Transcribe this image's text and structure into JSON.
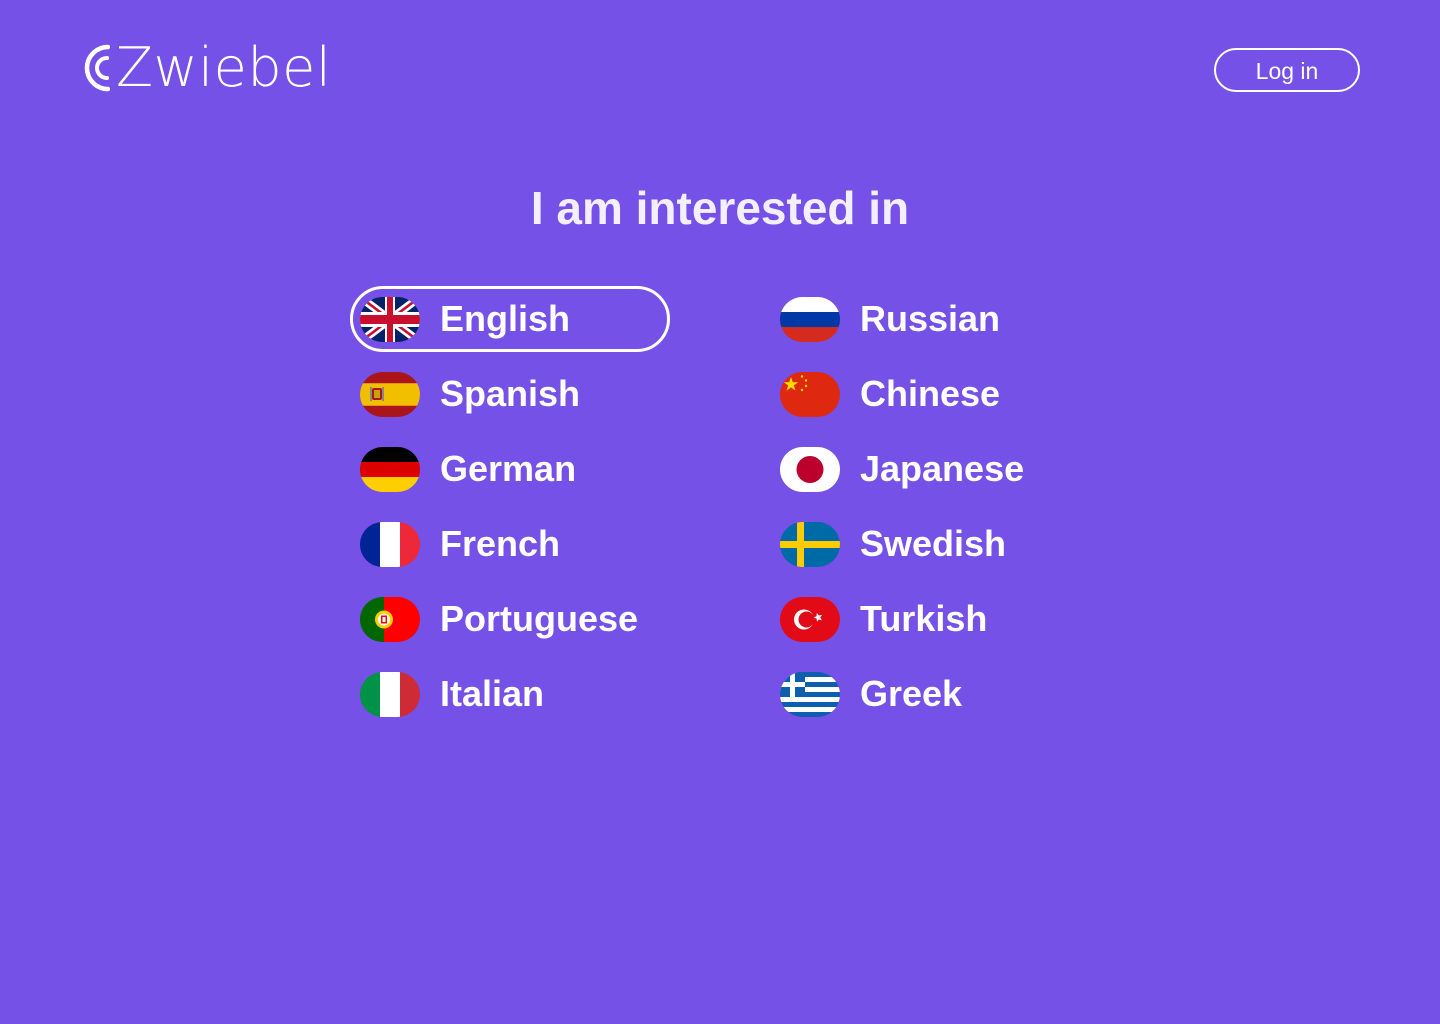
{
  "brand": {
    "name": "Zwiebel"
  },
  "header": {
    "login_label": "Log in"
  },
  "main": {
    "title": "I am interested in",
    "selected_language": "English",
    "languages": [
      {
        "label": "English",
        "flag": "uk-flag-icon"
      },
      {
        "label": "Spanish",
        "flag": "spain-flag-icon"
      },
      {
        "label": "German",
        "flag": "germany-flag-icon"
      },
      {
        "label": "French",
        "flag": "france-flag-icon"
      },
      {
        "label": "Portuguese",
        "flag": "portugal-flag-icon"
      },
      {
        "label": "Italian",
        "flag": "italy-flag-icon"
      },
      {
        "label": "Russian",
        "flag": "russia-flag-icon"
      },
      {
        "label": "Chinese",
        "flag": "china-flag-icon"
      },
      {
        "label": "Japanese",
        "flag": "japan-flag-icon"
      },
      {
        "label": "Swedish",
        "flag": "sweden-flag-icon"
      },
      {
        "label": "Turkish",
        "flag": "turkey-flag-icon"
      },
      {
        "label": "Greek",
        "flag": "greece-flag-icon"
      }
    ]
  },
  "colors": {
    "background": "#7551E8",
    "text": "#FFFFFF"
  }
}
